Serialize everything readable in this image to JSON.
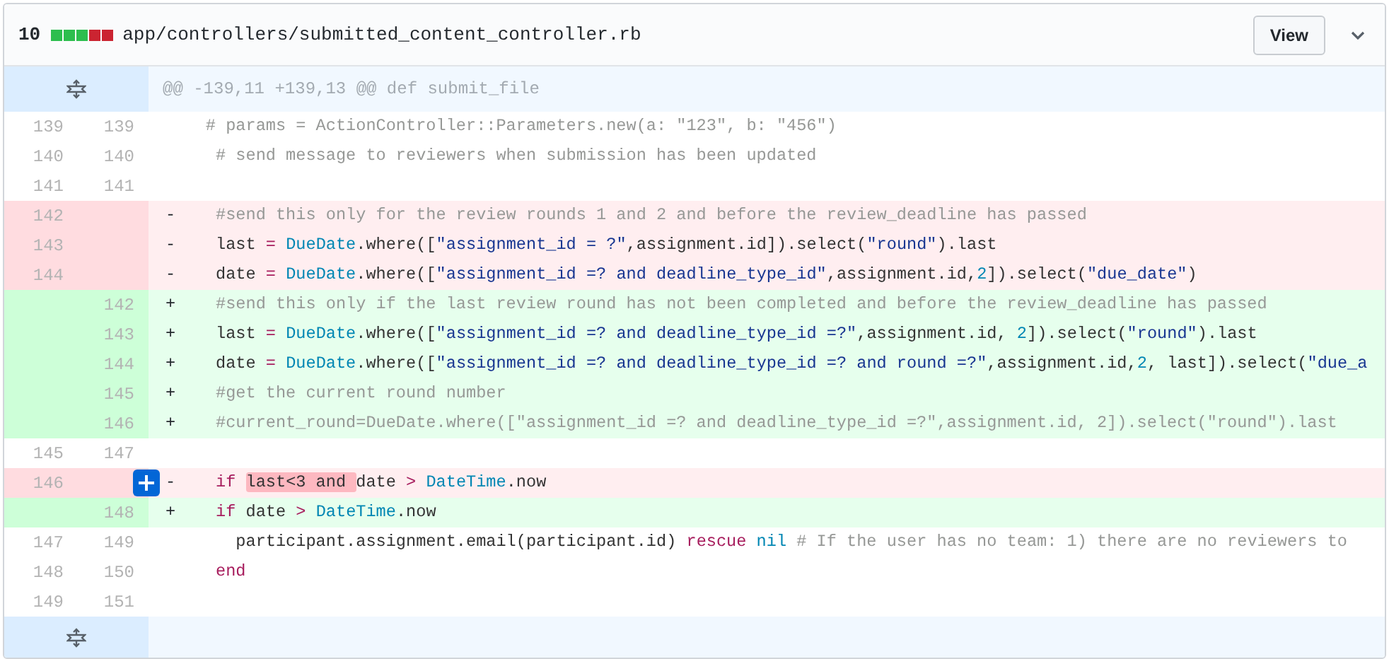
{
  "file": {
    "changes": "10",
    "stat": [
      {
        "kind": "added"
      },
      {
        "kind": "added"
      },
      {
        "kind": "added"
      },
      {
        "kind": "deleted"
      },
      {
        "kind": "deleted"
      }
    ],
    "path": "app/controllers/submitted_content_controller.rb",
    "view_button": "View"
  },
  "rows": [
    {
      "kind": "hunk",
      "text": "@@ -139,11 +139,13 @@ def submit_file"
    },
    {
      "kind": "context",
      "old": "139",
      "new": "139",
      "comment_button": false,
      "tokens": [
        {
          "kind": "comment",
          "text": "   # params = ActionController::Parameters.new(a: \"123\", b: \"456\")"
        }
      ]
    },
    {
      "kind": "context",
      "old": "140",
      "new": "140",
      "comment_button": false,
      "tokens": [
        {
          "kind": "comment",
          "text": "    # send message to reviewers when submission has been updated"
        }
      ]
    },
    {
      "kind": "context",
      "old": "141",
      "new": "141",
      "comment_button": false
    },
    {
      "kind": "deleted",
      "old": "142",
      "sign": "-",
      "comment_button": false,
      "tokens": [
        {
          "kind": "comment",
          "text": "    #send this only for the review rounds 1 and 2 and before the review_deadline has passed"
        }
      ]
    },
    {
      "kind": "deleted",
      "old": "143",
      "sign": "-",
      "comment_button": false,
      "tokens": [
        {
          "kind": "plain",
          "text": "    last "
        },
        {
          "kind": "keyword",
          "text": "= "
        },
        {
          "kind": "constant",
          "text": "DueDate"
        },
        {
          "kind": "plain",
          "text": ".where(["
        },
        {
          "kind": "string",
          "text": "\"assignment_id = ?\""
        },
        {
          "kind": "plain",
          "text": ",assignment.id]).select("
        },
        {
          "kind": "string",
          "text": "\"round\""
        },
        {
          "kind": "plain",
          "text": ").last"
        }
      ]
    },
    {
      "kind": "deleted",
      "old": "144",
      "sign": "-",
      "comment_button": false,
      "tokens": [
        {
          "kind": "plain",
          "text": "    date "
        },
        {
          "kind": "keyword",
          "text": "= "
        },
        {
          "kind": "constant",
          "text": "DueDate"
        },
        {
          "kind": "plain",
          "text": ".where(["
        },
        {
          "kind": "string",
          "text": "\"assignment_id =? and deadline_type_id\""
        },
        {
          "kind": "plain",
          "text": ",assignment.id,"
        },
        {
          "kind": "constant",
          "text": "2"
        },
        {
          "kind": "plain",
          "text": "]).select("
        },
        {
          "kind": "string",
          "text": "\"due_date\""
        },
        {
          "kind": "plain",
          "text": ")"
        }
      ]
    },
    {
      "kind": "added",
      "new": "142",
      "sign": "+",
      "comment_button": false,
      "tokens": [
        {
          "kind": "comment",
          "text": "    #send this only if the last review round has not been completed and before the review_deadline has passed"
        }
      ]
    },
    {
      "kind": "added",
      "new": "143",
      "sign": "+",
      "comment_button": false,
      "tokens": [
        {
          "kind": "plain",
          "text": "    last "
        },
        {
          "kind": "keyword",
          "text": "= "
        },
        {
          "kind": "constant",
          "text": "DueDate"
        },
        {
          "kind": "plain",
          "text": ".where(["
        },
        {
          "kind": "string",
          "text": "\"assignment_id =? and deadline_type_id =?\""
        },
        {
          "kind": "plain",
          "text": ",assignment.id, "
        },
        {
          "kind": "constant",
          "text": "2"
        },
        {
          "kind": "plain",
          "text": "]).select("
        },
        {
          "kind": "string",
          "text": "\"round\""
        },
        {
          "kind": "plain",
          "text": ").last"
        }
      ]
    },
    {
      "kind": "added",
      "new": "144",
      "sign": "+",
      "comment_button": false,
      "tokens": [
        {
          "kind": "plain",
          "text": "    date "
        },
        {
          "kind": "keyword",
          "text": "= "
        },
        {
          "kind": "constant",
          "text": "DueDate"
        },
        {
          "kind": "plain",
          "text": ".where(["
        },
        {
          "kind": "string",
          "text": "\"assignment_id =? and deadline_type_id =? and round =?\""
        },
        {
          "kind": "plain",
          "text": ",assignment.id,"
        },
        {
          "kind": "constant",
          "text": "2"
        },
        {
          "kind": "plain",
          "text": ", last]).select("
        },
        {
          "kind": "string",
          "text": "\"due_a"
        }
      ]
    },
    {
      "kind": "added",
      "new": "145",
      "sign": "+",
      "comment_button": false,
      "tokens": [
        {
          "kind": "comment",
          "text": "    #get the current round number"
        }
      ]
    },
    {
      "kind": "added",
      "new": "146",
      "sign": "+",
      "comment_button": false,
      "tokens": [
        {
          "kind": "comment",
          "text": "    #current_round=DueDate.where([\"assignment_id =? and deadline_type_id =?\",assignment.id, 2]).select(\"round\").last"
        }
      ]
    },
    {
      "kind": "context",
      "old": "145",
      "new": "147",
      "comment_button": false
    },
    {
      "kind": "deleted",
      "old": "146",
      "sign": "-",
      "comment_button": true,
      "tokens": [
        {
          "kind": "keyword",
          "text": "    if "
        },
        {
          "kind": "highlight",
          "text": "last<3 and "
        },
        {
          "kind": "plain",
          "text": "date "
        },
        {
          "kind": "keyword",
          "text": "> "
        },
        {
          "kind": "constant",
          "text": "DateTime"
        },
        {
          "kind": "plain",
          "text": ".now"
        }
      ]
    },
    {
      "kind": "added",
      "new": "148",
      "sign": "+",
      "comment_button": false,
      "tokens": [
        {
          "kind": "keyword",
          "text": "    if"
        },
        {
          "kind": "plain",
          "text": " date "
        },
        {
          "kind": "keyword",
          "text": "> "
        },
        {
          "kind": "constant",
          "text": "DateTime"
        },
        {
          "kind": "plain",
          "text": ".now"
        }
      ]
    },
    {
      "kind": "context",
      "old": "147",
      "new": "149",
      "comment_button": false,
      "tokens": [
        {
          "kind": "plain",
          "text": "      participant.assignment.email(participant.id) "
        },
        {
          "kind": "keyword",
          "text": "rescue "
        },
        {
          "kind": "constant",
          "text": "nil"
        },
        {
          "kind": "comment",
          "text": " # If the user has no team: 1) there are no reviewers to"
        }
      ]
    },
    {
      "kind": "context",
      "old": "148",
      "new": "150",
      "comment_button": false,
      "tokens": [
        {
          "kind": "keyword",
          "text": "    end"
        }
      ]
    },
    {
      "kind": "context",
      "old": "149",
      "new": "151",
      "comment_button": false
    },
    {
      "kind": "expander"
    }
  ]
}
